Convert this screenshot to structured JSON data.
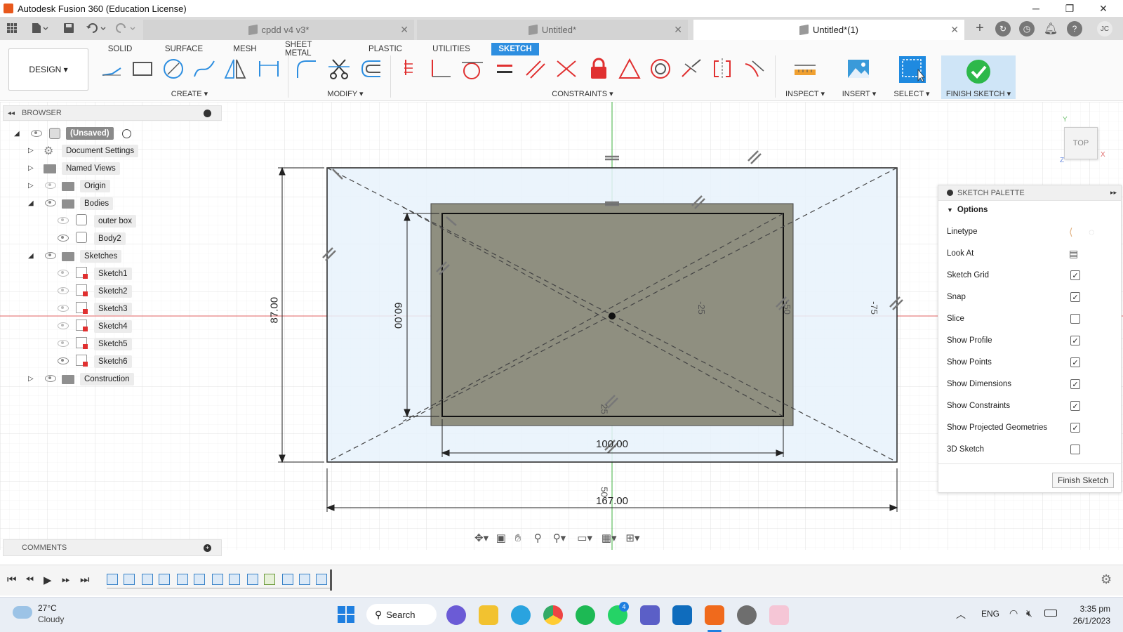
{
  "window": {
    "title": "Autodesk Fusion 360 (Education License)",
    "minimize": "─",
    "maximize": "❐",
    "close": "✕"
  },
  "doc_tabs": [
    {
      "label": "cpdd v4 v3*",
      "active": false
    },
    {
      "label": "Untitled*",
      "active": false
    },
    {
      "label": "Untitled*(1)",
      "active": true
    }
  ],
  "tab_close": "✕",
  "user_initials": "JC",
  "ribbon": {
    "workspace": "DESIGN ▾",
    "tabs": [
      "SOLID",
      "SURFACE",
      "MESH",
      "SHEET METAL",
      "PLASTIC",
      "UTILITIES",
      "SKETCH"
    ],
    "active_tab": "SKETCH",
    "groups": {
      "create": "CREATE ▾",
      "modify": "MODIFY ▾",
      "constraints": "CONSTRAINTS ▾",
      "inspect": "INSPECT ▾",
      "insert": "INSERT ▾",
      "select": "SELECT ▾",
      "finish": "FINISH SKETCH ▾"
    }
  },
  "browser": {
    "title": "BROWSER",
    "root": "(Unsaved)",
    "items": [
      {
        "label": "Document Settings"
      },
      {
        "label": "Named Views"
      },
      {
        "label": "Origin"
      },
      {
        "label": "Bodies"
      },
      {
        "label": "outer box"
      },
      {
        "label": "Body2"
      },
      {
        "label": "Sketches"
      },
      {
        "label": "Sketch1"
      },
      {
        "label": "Sketch2"
      },
      {
        "label": "Sketch3"
      },
      {
        "label": "Sketch4"
      },
      {
        "label": "Sketch5"
      },
      {
        "label": "Sketch6"
      },
      {
        "label": "Construction"
      }
    ]
  },
  "comments": {
    "title": "COMMENTS"
  },
  "viewcube": {
    "face": "TOP",
    "axis_y": "Y",
    "axis_x": "X",
    "axis_z": "Z"
  },
  "dimensions": {
    "outer_height": "87.00",
    "inner_height": "60.00",
    "inner_width": "100.00",
    "outer_width": "167.00",
    "label_neg25": "-25",
    "label_neg50": "-50",
    "label_neg75": "-75",
    "label_25": "25",
    "label_50": "50"
  },
  "palette": {
    "title": "SKETCH PALETTE",
    "section": "Options",
    "rows": [
      {
        "label": "Linetype"
      },
      {
        "label": "Look At"
      },
      {
        "label": "Sketch Grid",
        "checked": true
      },
      {
        "label": "Snap",
        "checked": true
      },
      {
        "label": "Slice",
        "checked": false
      },
      {
        "label": "Show Profile",
        "checked": true
      },
      {
        "label": "Show Points",
        "checked": true
      },
      {
        "label": "Show Dimensions",
        "checked": true
      },
      {
        "label": "Show Constraints",
        "checked": true
      },
      {
        "label": "Show Projected Geometries",
        "checked": true
      },
      {
        "label": "3D Sketch",
        "checked": false
      }
    ],
    "finish_button": "Finish Sketch"
  },
  "taskbar": {
    "weather_temp": "27°C",
    "weather_desc": "Cloudy",
    "search": "Search",
    "lang": "ENG",
    "time": "3:35 pm",
    "date": "26/1/2023",
    "whatsapp_badge": "4"
  },
  "colors": {
    "accent": "#2d8ee0",
    "sketch_fill": "#e8f2fb",
    "body_fill": "#8f8f80",
    "finish_bg": "#cfe5f7"
  }
}
